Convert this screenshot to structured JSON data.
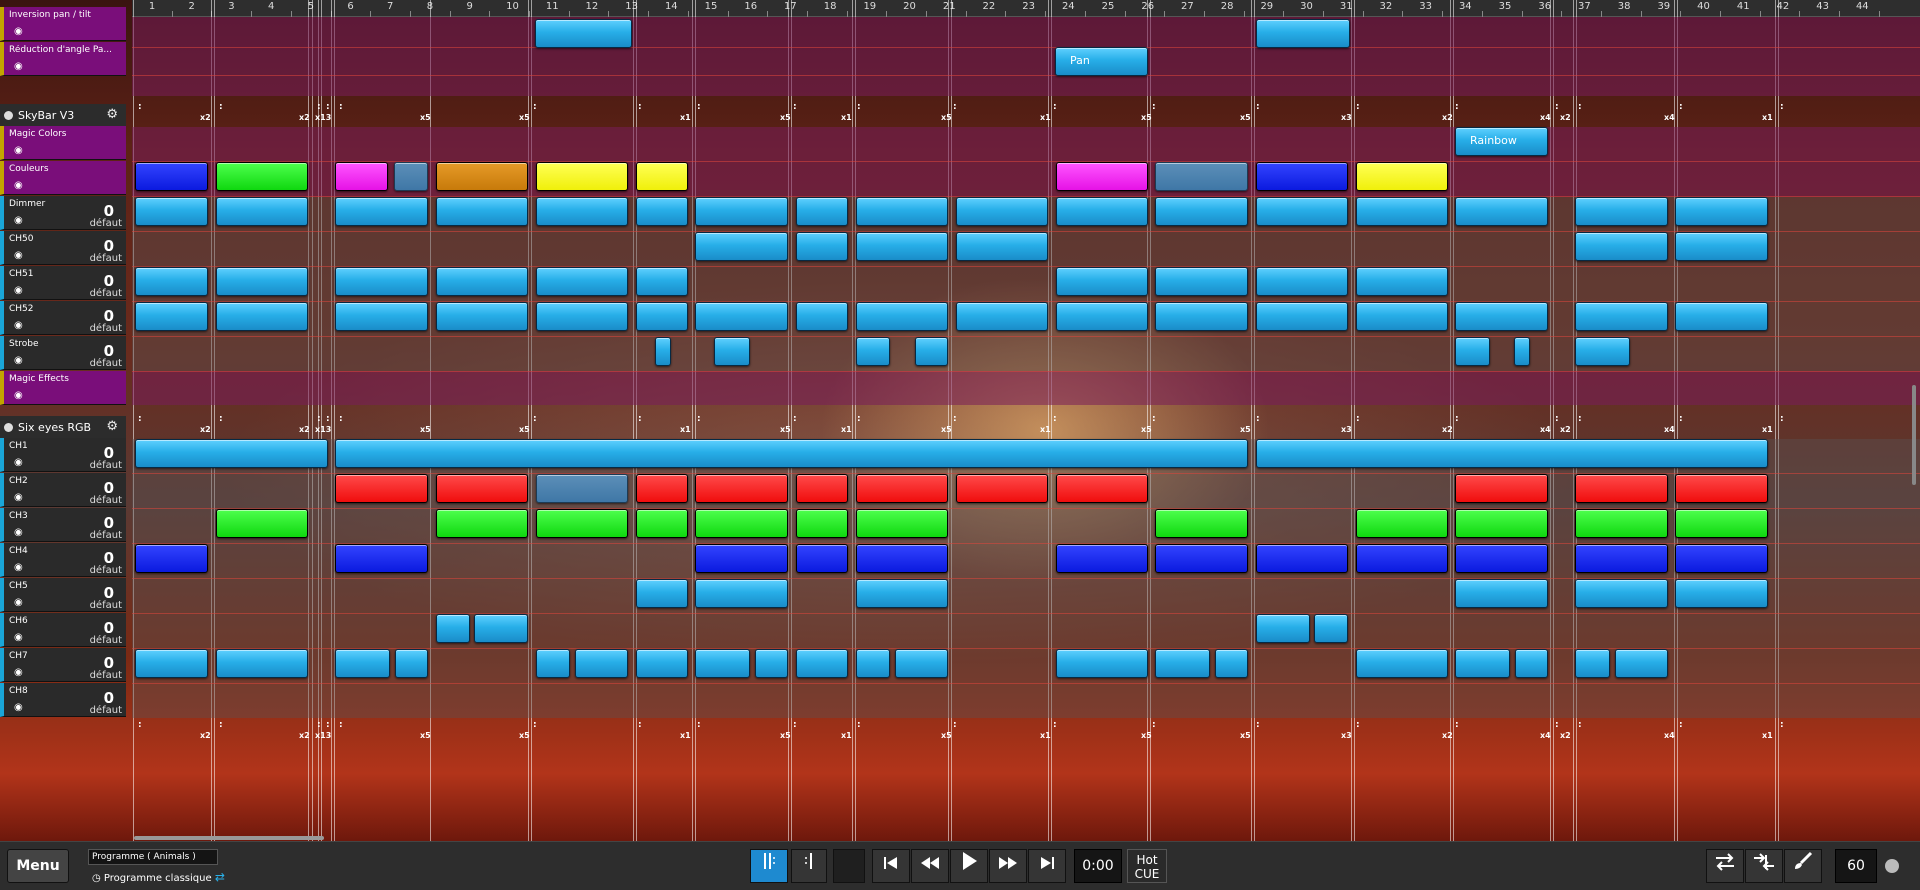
{
  "ruler": {
    "ticks": [
      "1",
      "2",
      "3",
      "4",
      "5",
      "6",
      "7",
      "8",
      "9",
      "10",
      "11",
      "12",
      "13",
      "14",
      "15",
      "16",
      "17",
      "18",
      "19",
      "20",
      "21",
      "22",
      "23",
      "24",
      "25",
      "26",
      "27",
      "28",
      "29",
      "30",
      "31",
      "32",
      "33",
      "34",
      "35",
      "36",
      "37",
      "38",
      "39",
      "40",
      "41",
      "42",
      "43",
      "44"
    ]
  },
  "fixtures": [
    {
      "title": "",
      "rows": [
        {
          "label": "Inversion pan / tilt",
          "type": "magic"
        },
        {
          "label": "Réduction d'angle Pa...",
          "type": "magic"
        }
      ]
    },
    {
      "title": "SkyBar V3",
      "rows": [
        {
          "label": "Magic Colors",
          "type": "magic"
        },
        {
          "label": "Couleurs",
          "type": "magic"
        },
        {
          "label": "Dimmer",
          "type": "chan",
          "value": "0",
          "default": "défaut"
        },
        {
          "label": "CH50",
          "type": "chan",
          "value": "0",
          "default": "défaut"
        },
        {
          "label": "CH51",
          "type": "chan",
          "value": "0",
          "default": "défaut"
        },
        {
          "label": "CH52",
          "type": "chan",
          "value": "0",
          "default": "défaut"
        },
        {
          "label": "Strobe",
          "type": "chan",
          "value": "0",
          "default": "défaut"
        },
        {
          "label": "Magic Effects",
          "type": "magic"
        }
      ]
    },
    {
      "title": "Six eyes RGB",
      "rows": [
        {
          "label": "CH1",
          "type": "chan",
          "value": "0",
          "default": "défaut"
        },
        {
          "label": "CH2",
          "type": "chan",
          "value": "0",
          "default": "défaut"
        },
        {
          "label": "CH3",
          "type": "chan",
          "value": "0",
          "default": "défaut"
        },
        {
          "label": "CH4",
          "type": "chan",
          "value": "0",
          "default": "défaut"
        },
        {
          "label": "CH5",
          "type": "chan",
          "value": "0",
          "default": "défaut"
        },
        {
          "label": "CH6",
          "type": "chan",
          "value": "0",
          "default": "défaut"
        },
        {
          "label": "CH7",
          "type": "chan",
          "value": "0",
          "default": "défaut"
        },
        {
          "label": "CH8",
          "type": "chan",
          "value": "0",
          "default": "défaut"
        }
      ]
    }
  ],
  "clips": {
    "pan_label": "Pan",
    "rainbow_label": "Rainbow"
  },
  "markers": [
    "x2",
    "x2",
    "x13",
    "x5",
    "x5",
    "x1",
    "x5",
    "x1",
    "x5",
    "x1",
    "x5",
    "x5",
    "x3",
    "x2",
    "x4",
    "x2",
    "x4",
    "x1"
  ],
  "bottom": {
    "menu_label": "Menu",
    "program_name": "Programme ( Animals )",
    "program_mode": "Programme classique",
    "time": "0:00",
    "hotcue_line1": "Hot",
    "hotcue_line2": "CUE",
    "bpm": "60"
  },
  "colors": {
    "clip_blue": "#27aee8",
    "clip_royal": "#0b1adf",
    "clip_green": "#0fd80f",
    "clip_red": "#f00d0d",
    "clip_magenta": "#e612e6",
    "clip_orange": "#c77a0a",
    "clip_yellow": "#f0f00a",
    "magic_row": "#7a0e7a",
    "active_toggle": "#1e8ad0"
  },
  "icons": [
    "eye-icon",
    "gear-icon",
    "skip-back-icon",
    "rewind-icon",
    "play-icon",
    "fast-forward-icon",
    "skip-forward-icon",
    "swap-icon",
    "merge-icon",
    "brush-icon",
    "loop-icon"
  ]
}
